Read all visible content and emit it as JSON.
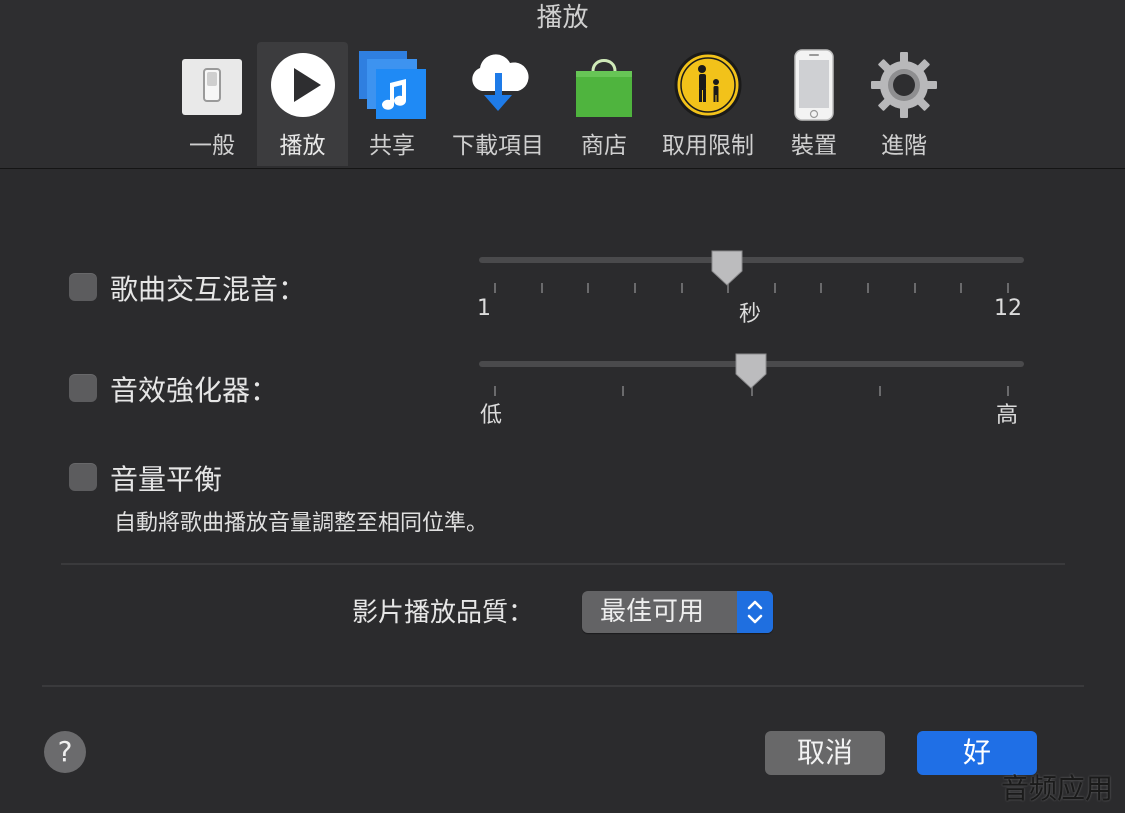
{
  "window": {
    "title": "播放"
  },
  "tabs": [
    {
      "label": "一般",
      "icon": "switch-icon"
    },
    {
      "label": "播放",
      "icon": "play-icon",
      "selected": true
    },
    {
      "label": "共享",
      "icon": "music-library-icon"
    },
    {
      "label": "下載項目",
      "icon": "cloud-download-icon"
    },
    {
      "label": "商店",
      "icon": "shopping-bag-icon"
    },
    {
      "label": "取用限制",
      "icon": "parental-controls-icon"
    },
    {
      "label": "裝置",
      "icon": "iphone-icon"
    },
    {
      "label": "進階",
      "icon": "gear-icon"
    }
  ],
  "crossfade": {
    "label": "歌曲交互混音：",
    "checked": false,
    "min_label": "1",
    "unit_label": "秒",
    "max_label": "12",
    "min": 1,
    "max": 12,
    "value": 6
  },
  "sound_enhancer": {
    "label": "音效強化器：",
    "checked": false,
    "min_label": "低",
    "max_label": "高",
    "value": 0.5
  },
  "sound_check": {
    "label": "音量平衡",
    "checked": false,
    "description": "自動將歌曲播放音量調整至相同位準。"
  },
  "video_quality": {
    "label": "影片播放品質：",
    "selected": "最佳可用"
  },
  "buttons": {
    "help": "?",
    "cancel": "取消",
    "ok": "好"
  },
  "watermark": "音频应用",
  "colors": {
    "accent": "#1f6fe6",
    "background": "#2b2b2d"
  }
}
